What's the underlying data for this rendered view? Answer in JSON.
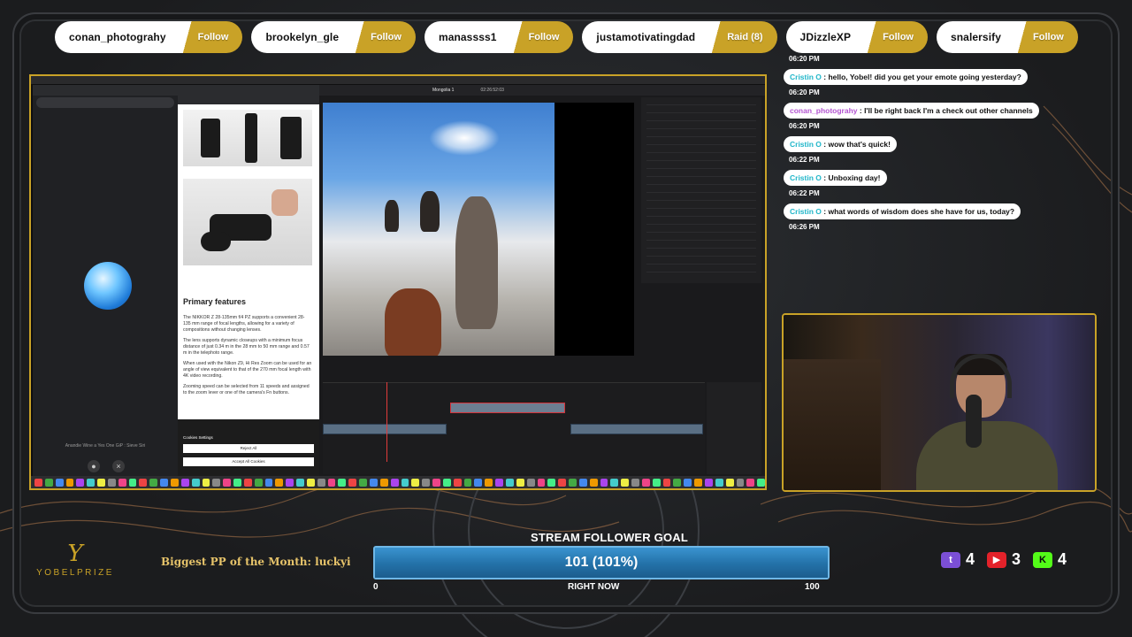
{
  "follow_bar": [
    {
      "name": "conan_photograhy",
      "action": "Follow"
    },
    {
      "name": "brookelyn_gle",
      "action": "Follow"
    },
    {
      "name": "manassss1",
      "action": "Follow"
    },
    {
      "name": "justamotivatingdad",
      "action": "Raid (8)"
    },
    {
      "name": "JDizzleXP",
      "action": "Follow"
    },
    {
      "name": "snalersify",
      "action": "Follow"
    }
  ],
  "chat": {
    "messages": [
      {
        "time": "06:20 PM",
        "user": "Cristin O",
        "text": " : hello, Yobel! did you get your emote going yesterday?"
      },
      {
        "time": "06:20 PM",
        "user": "conan_photograhy",
        "text": " : I'll be right back I'm a check out other channels"
      },
      {
        "time": "06:20 PM",
        "user": "Cristin O",
        "text": " : wow that's quick!"
      },
      {
        "time": "06:22 PM",
        "user": "Cristin O",
        "text": " : Unboxing day!"
      },
      {
        "time": "06:22 PM",
        "user": "Cristin O",
        "text": " : what words of wisdom does she have for us, today?"
      }
    ],
    "last_time": "06:26 PM"
  },
  "screen": {
    "document_heading": "Primary features",
    "document_paragraphs": [
      "The NIKKOR Z 28-135mm f/4 PZ supports a convenient 28-135 mm range of focal lengths, allowing for a variety of compositions without changing lenses.",
      "The lens supports dynamic closeups with a minimum focus distance of just 0.34 m in the 28 mm to 50 mm range and 0.57 m in the telephoto range.",
      "When used with the Nikon Z9, Hi Res Zoom can be used for an angle of view equivalent to that of the 270 mm focal length with 4K video recording.",
      "Zooming speed can be selected from 11 speeds and assigned to the zoom lever or one of the camera's Fn buttons."
    ],
    "cookie_buttons": [
      "Reject All",
      "Accept All Cookies"
    ],
    "cookie_settings": "Cookies Settings",
    "resolve_title": "Mongolia 1",
    "timecode": "02:26:52:03",
    "siri_caption": "Anandie Wine a Yes One GiP : Sieve Siri"
  },
  "brand": {
    "mark": "Y",
    "name": "YOBELPRIZE"
  },
  "ticker": "Biggest PP of the Month: luckyir",
  "goal": {
    "title": "STREAM FOLLOWER GOAL",
    "value": "101 (101%)",
    "min": "0",
    "max": "100",
    "now_label": "RIGHT NOW",
    "fraction": 1.0
  },
  "platforms": [
    {
      "icon": "twitch-icon",
      "glyph": "t",
      "count": "4"
    },
    {
      "icon": "youtube-icon",
      "glyph": "▶",
      "count": "3"
    },
    {
      "icon": "kick-icon",
      "glyph": "K",
      "count": "4"
    }
  ],
  "colors": {
    "accent_gold": "#c9a227",
    "goal_blue": "#2371a8",
    "cristin": "#1fb6c9",
    "conan": "#b455d2"
  }
}
